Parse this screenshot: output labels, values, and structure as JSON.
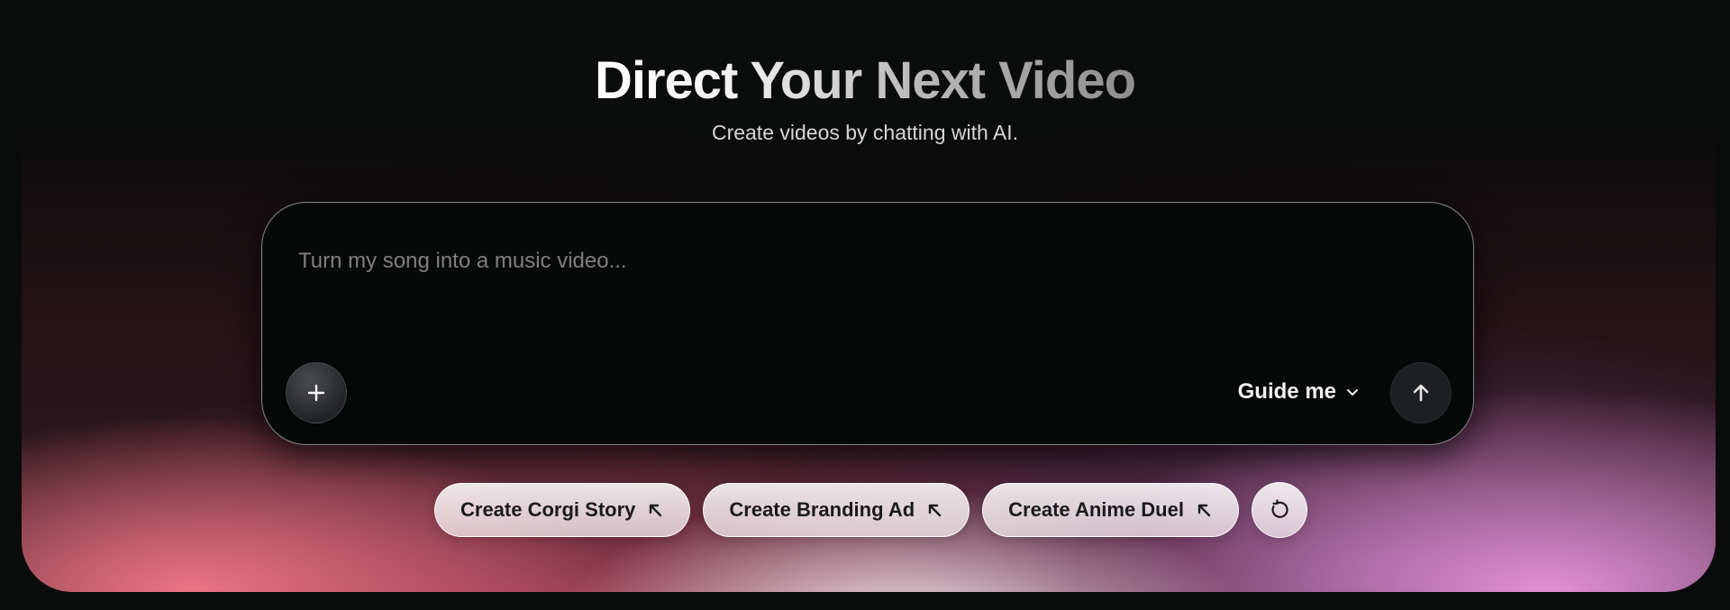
{
  "hero": {
    "title": "Direct Your Next Video",
    "subtitle": "Create videos by chatting with AI."
  },
  "prompt": {
    "placeholder": "Turn my song into a music video...",
    "value": "",
    "add_icon": "plus-icon",
    "guide_label": "Guide me",
    "guide_icon": "chevron-down-icon",
    "send_icon": "arrow-up-icon"
  },
  "suggestions": [
    {
      "label": "Create Corgi Story",
      "icon": "arrow-up-left-icon"
    },
    {
      "label": "Create Branding Ad",
      "icon": "arrow-up-left-icon"
    },
    {
      "label": "Create Anime Duel",
      "icon": "arrow-up-left-icon"
    }
  ],
  "refresh_icon": "refresh-icon",
  "colors": {
    "background": "#0a0c0c",
    "glow_left": "#f47887",
    "glow_center": "#fff6fa",
    "glow_right": "#e896dc",
    "chip_text": "#1b1b1d"
  }
}
